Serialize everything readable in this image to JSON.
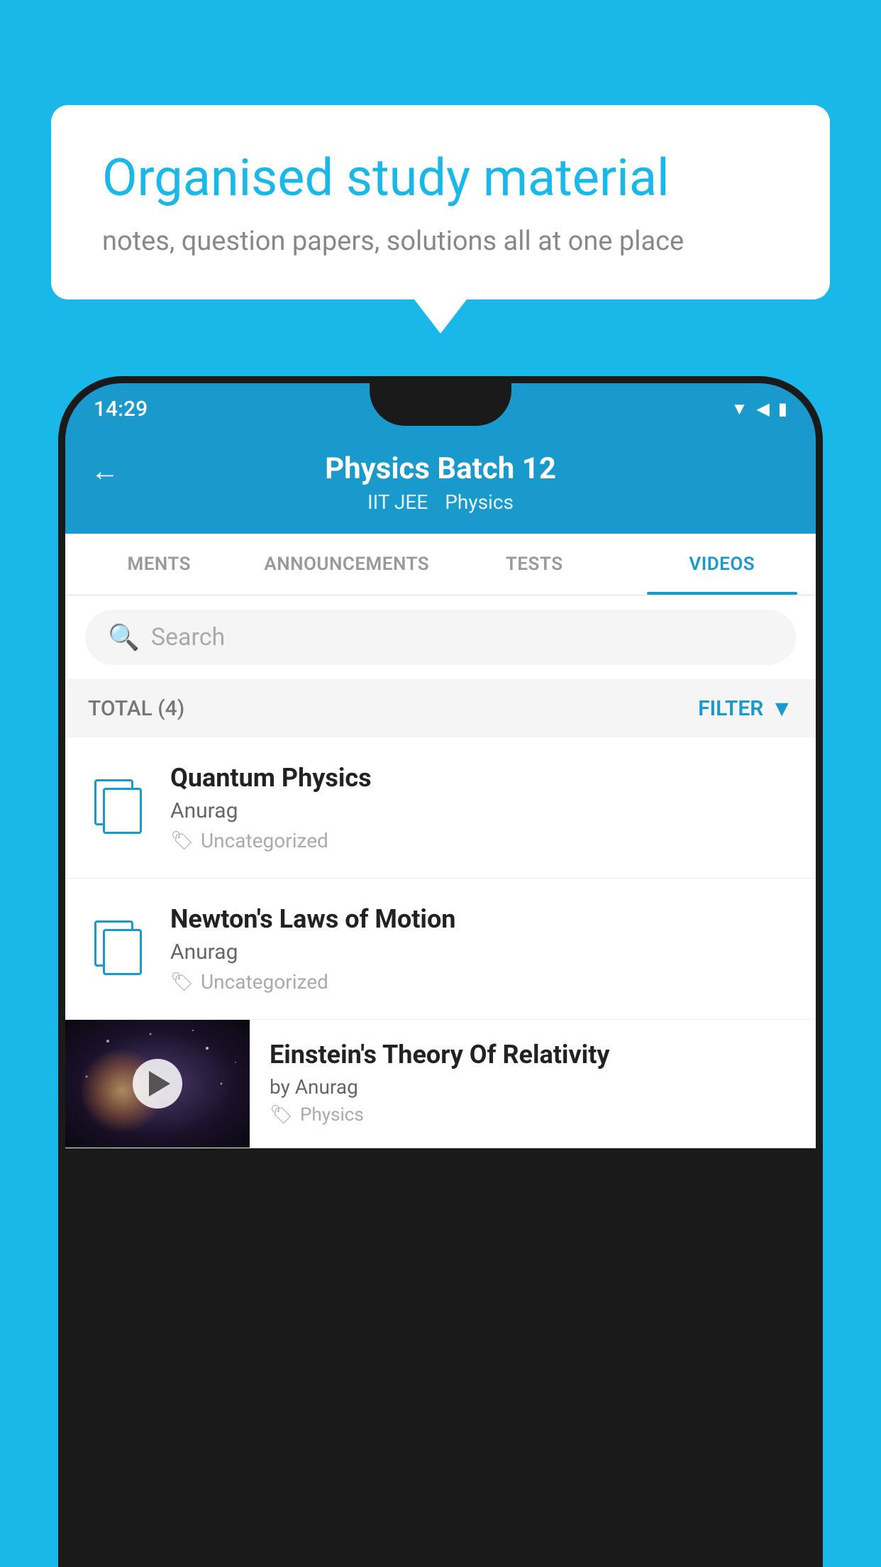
{
  "background_color": "#1ab8e8",
  "speech_bubble": {
    "title": "Organised study material",
    "subtitle": "notes, question papers, solutions all at one place"
  },
  "status_bar": {
    "time": "14:29",
    "icons": [
      "wifi",
      "signal",
      "battery"
    ]
  },
  "app_header": {
    "back_label": "←",
    "title": "Physics Batch 12",
    "tags": [
      "IIT JEE",
      "Physics"
    ]
  },
  "tabs": [
    {
      "label": "MENTS",
      "active": false
    },
    {
      "label": "ANNOUNCEMENTS",
      "active": false
    },
    {
      "label": "TESTS",
      "active": false
    },
    {
      "label": "VIDEOS",
      "active": true
    }
  ],
  "search": {
    "placeholder": "Search"
  },
  "filter_row": {
    "total_label": "TOTAL (4)",
    "filter_label": "FILTER"
  },
  "videos": [
    {
      "id": 1,
      "title": "Quantum Physics",
      "author": "Anurag",
      "tag": "Uncategorized",
      "has_thumbnail": false
    },
    {
      "id": 2,
      "title": "Newton's Laws of Motion",
      "author": "Anurag",
      "tag": "Uncategorized",
      "has_thumbnail": false
    },
    {
      "id": 3,
      "title": "Einstein's Theory Of Relativity",
      "author": "by Anurag",
      "tag": "Physics",
      "has_thumbnail": true
    }
  ]
}
